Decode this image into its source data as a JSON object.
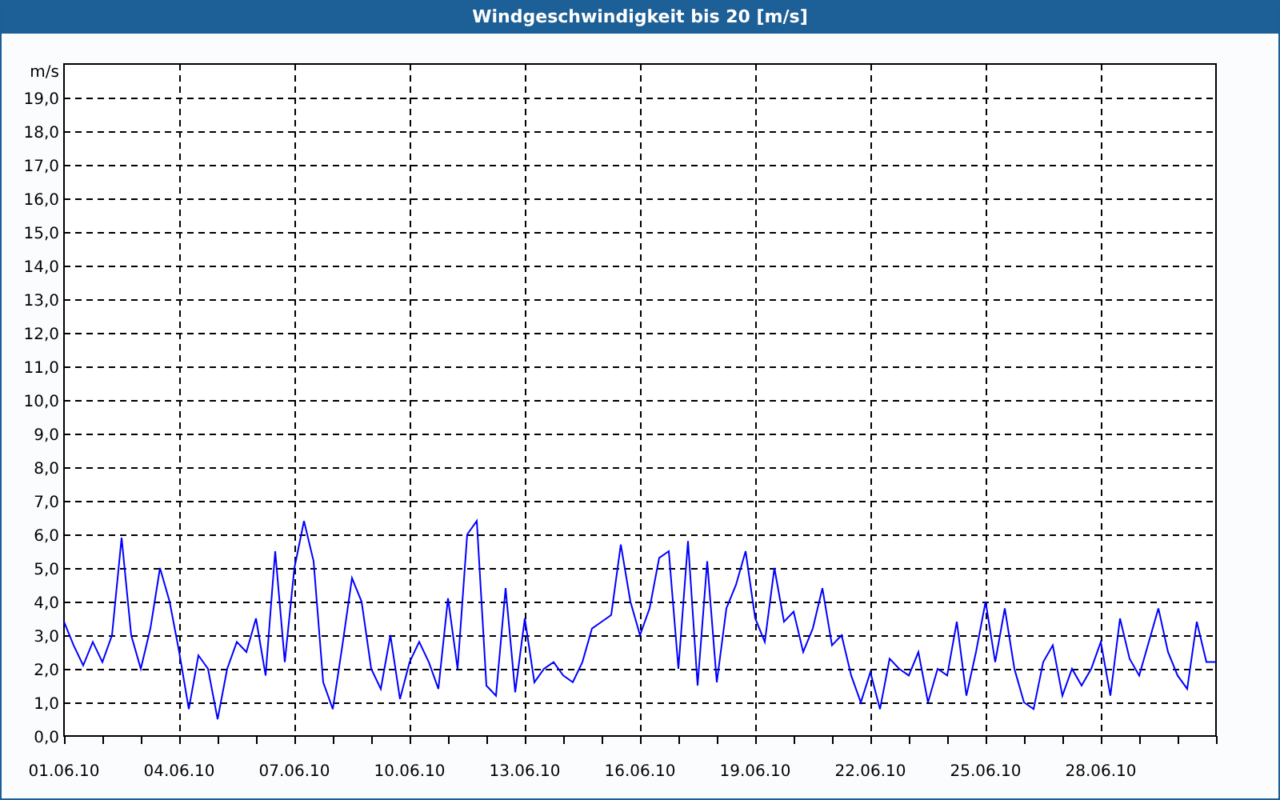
{
  "window": {
    "title": "Windgeschwindigkeit bis 20 [m/s]"
  },
  "chart_data": {
    "type": "line",
    "grid": true,
    "ylabel": "m/s",
    "ylim": [
      0,
      20
    ],
    "categories": [
      "01.06.10",
      null,
      null,
      null,
      null,
      null,
      null,
      null,
      null,
      null,
      null,
      null,
      "04.06.10",
      null,
      null,
      null,
      null,
      null,
      null,
      null,
      null,
      null,
      null,
      null,
      "07.06.10",
      null,
      null,
      null,
      null,
      null,
      null,
      null,
      null,
      null,
      null,
      null,
      "10.06.10",
      null,
      null,
      null,
      null,
      null,
      null,
      null,
      null,
      null,
      null,
      null,
      "13.06.10",
      null,
      null,
      null,
      null,
      null,
      null,
      null,
      null,
      null,
      null,
      null,
      "16.06.10",
      null,
      null,
      null,
      null,
      null,
      null,
      null,
      null,
      null,
      null,
      null,
      "19.06.10",
      null,
      null,
      null,
      null,
      null,
      null,
      null,
      null,
      null,
      null,
      null,
      "22.06.10",
      null,
      null,
      null,
      null,
      null,
      null,
      null,
      null,
      null,
      null,
      null,
      "25.06.10",
      null,
      null,
      null,
      null,
      null,
      null,
      null,
      null,
      null,
      null,
      null,
      "28.06.10",
      null,
      null,
      null,
      null,
      null,
      null,
      null,
      null,
      null,
      null,
      null,
      null
    ],
    "series": [
      {
        "color": "#0000ff",
        "values": [
          3.4,
          2.7,
          2.1,
          2.8,
          2.2,
          3.0,
          5.9,
          3.0,
          2.0,
          3.2,
          5.0,
          4.0,
          2.5,
          0.8,
          2.4,
          2.0,
          0.5,
          2.0,
          2.8,
          2.5,
          3.5,
          1.8,
          5.5,
          2.2,
          5.0,
          6.4,
          5.2,
          1.6,
          0.8,
          2.7,
          4.7,
          4.0,
          2.0,
          1.4,
          3.0,
          1.1,
          2.2,
          2.8,
          2.2,
          1.4,
          4.1,
          2.0,
          6.0,
          6.4,
          1.5,
          1.2,
          4.4,
          1.3,
          3.5,
          1.6,
          2.0,
          2.2,
          1.8,
          1.6,
          2.2,
          3.2,
          3.4,
          3.6,
          5.7,
          4.0,
          3.0,
          3.8,
          5.3,
          5.5,
          2.0,
          5.8,
          1.5,
          5.2,
          1.6,
          3.8,
          4.5,
          5.5,
          3.5,
          2.8,
          5.0,
          3.4,
          3.7,
          2.5,
          3.2,
          4.4,
          2.7,
          3.0,
          1.8,
          1.0,
          1.9,
          0.8,
          2.3,
          2.0,
          1.8,
          2.5,
          1.0,
          2.0,
          1.8,
          3.4,
          1.2,
          2.5,
          4.0,
          2.2,
          3.8,
          2.0,
          1.0,
          0.8,
          2.2,
          2.7,
          1.2,
          2.0,
          1.5,
          2.0,
          2.8,
          1.2,
          3.5,
          2.3,
          1.8,
          2.8,
          3.8,
          2.5,
          1.8,
          1.4,
          3.4,
          2.2,
          2.2
        ]
      }
    ],
    "yticks": [
      {
        "value": 0,
        "label": "0,0"
      },
      {
        "value": 1,
        "label": "1,0"
      },
      {
        "value": 2,
        "label": "2,0"
      },
      {
        "value": 3,
        "label": "3,0"
      },
      {
        "value": 4,
        "label": "4,0"
      },
      {
        "value": 5,
        "label": "5,0"
      },
      {
        "value": 6,
        "label": "6,0"
      },
      {
        "value": 7,
        "label": "7,0"
      },
      {
        "value": 8,
        "label": "8,0"
      },
      {
        "value": 9,
        "label": "9,0"
      },
      {
        "value": 10,
        "label": "10,0"
      },
      {
        "value": 11,
        "label": "11,0"
      },
      {
        "value": 12,
        "label": "12,0"
      },
      {
        "value": 13,
        "label": "13,0"
      },
      {
        "value": 14,
        "label": "14,0"
      },
      {
        "value": 15,
        "label": "15,0"
      },
      {
        "value": 16,
        "label": "16,0"
      },
      {
        "value": 17,
        "label": "17,0"
      },
      {
        "value": 18,
        "label": "18,0"
      },
      {
        "value": 19,
        "label": "19,0"
      }
    ]
  }
}
